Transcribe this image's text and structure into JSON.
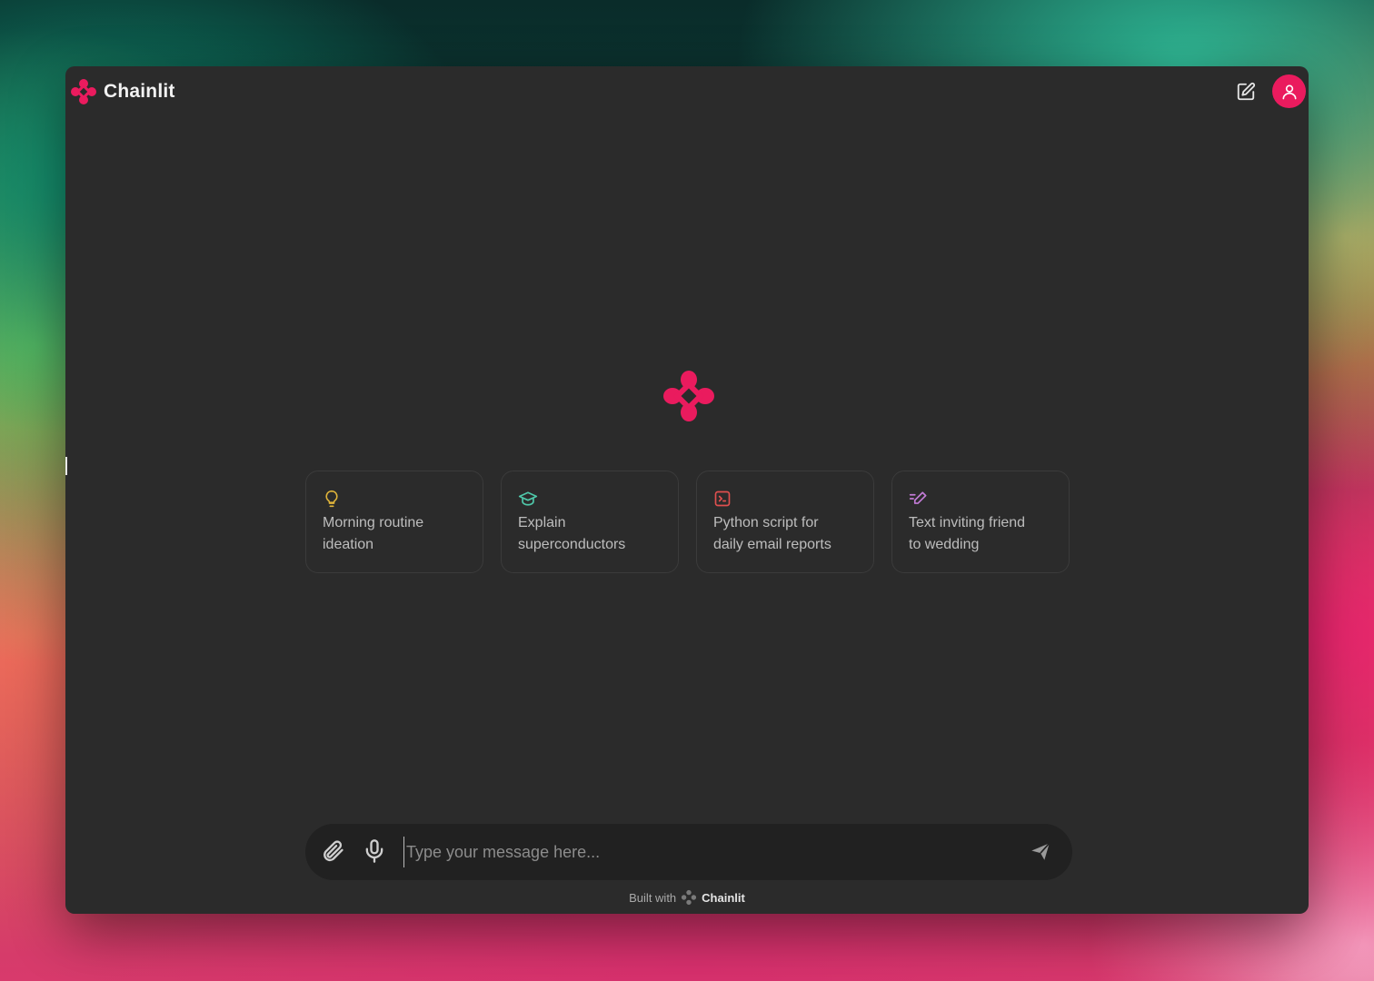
{
  "app": {
    "brand_name": "Chainlit",
    "brand_color": "#ea1b5e"
  },
  "header": {
    "new_chat_icon": "edit-square-icon",
    "user_icon": "user-icon"
  },
  "starters": [
    {
      "label": "Morning routine ideation",
      "line1": "Morning routine",
      "line2": "ideation",
      "icon": "lightbulb-icon",
      "icon_color": "#e0b43a"
    },
    {
      "label": "Explain superconductors",
      "line1": "Explain",
      "line2": "superconductors",
      "icon": "graduation-cap-icon",
      "icon_color": "#4fc7a9"
    },
    {
      "label": "Python script for daily email reports",
      "line1": "Python script for",
      "line2": "daily email reports",
      "icon": "terminal-icon",
      "icon_color": "#e0504f"
    },
    {
      "label": "Text inviting friend to wedding",
      "line1": "Text inviting friend",
      "line2": "to wedding",
      "icon": "pen-lines-icon",
      "icon_color": "#c27bd6"
    }
  ],
  "composer": {
    "placeholder": "Type your message here...",
    "value": "",
    "attach_icon": "paperclip-icon",
    "mic_icon": "microphone-icon",
    "send_icon": "send-icon"
  },
  "footer": {
    "prefix": "Built with",
    "brand": "Chainlit"
  }
}
